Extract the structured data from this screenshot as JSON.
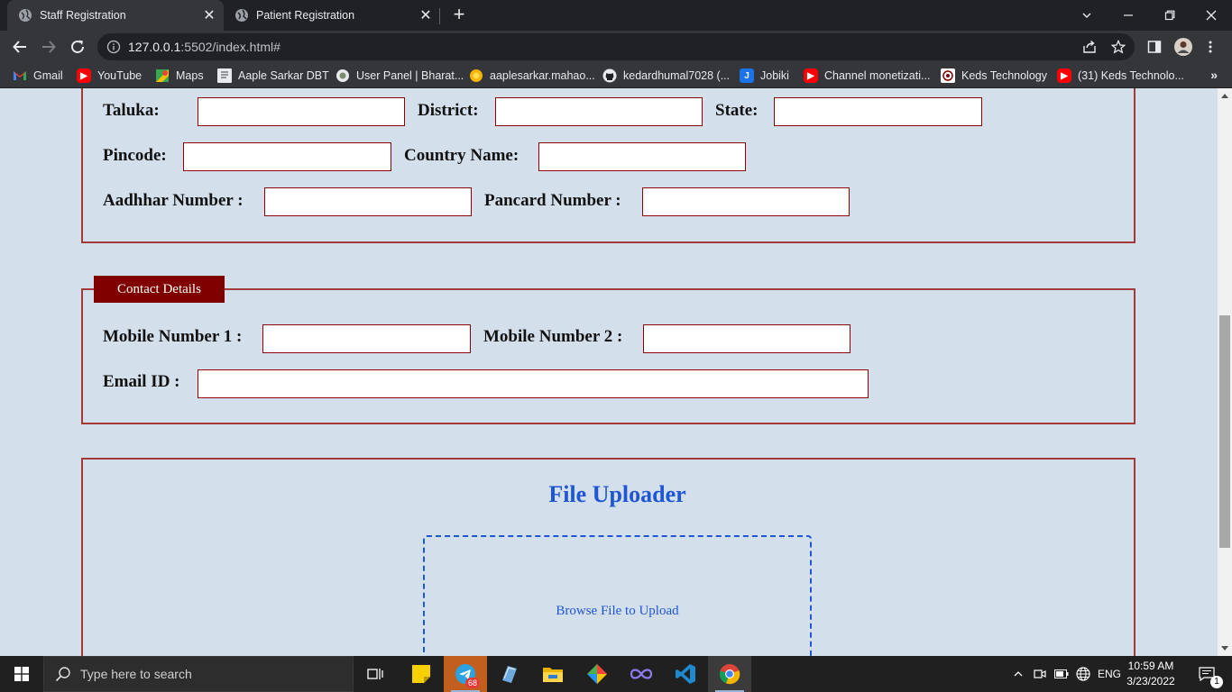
{
  "browser": {
    "tabs": [
      {
        "title": "Staff Registration",
        "active": true
      },
      {
        "title": "Patient Registration",
        "active": false
      }
    ],
    "url": {
      "host": "127.0.0.1",
      "rest": ":5502/index.html#"
    },
    "bookmarks": [
      {
        "label": "Gmail",
        "icon": "gmail-icon"
      },
      {
        "label": "YouTube",
        "icon": "youtube-icon"
      },
      {
        "label": "Maps",
        "icon": "maps-icon"
      },
      {
        "label": "Aaple Sarkar DBT",
        "icon": "document-icon"
      },
      {
        "label": "User Panel | Bharat...",
        "icon": "globe-icon"
      },
      {
        "label": "aaplesarkar.mahao...",
        "icon": "sun-icon"
      },
      {
        "label": "kedardhumal7028 (...",
        "icon": "github-icon"
      },
      {
        "label": "Jobiki",
        "icon": "jobiki-icon"
      },
      {
        "label": "Channel monetizati...",
        "icon": "youtube-icon"
      },
      {
        "label": "Keds Technology",
        "icon": "keds-icon"
      },
      {
        "label": "(31) Keds Technolo...",
        "icon": "youtube-icon"
      }
    ],
    "more_bookmarks": "»"
  },
  "form": {
    "address": {
      "taluka_label": "Taluka:",
      "district_label": "District:",
      "state_label": "State:",
      "pincode_label": "Pincode:",
      "country_label": "Country Name:",
      "aadhaar_label": "Aadhhar Number :",
      "pancard_label": "Pancard Number :",
      "taluka_value": "",
      "district_value": "",
      "state_value": "",
      "pincode_value": "",
      "country_value": "",
      "aadhaar_value": "",
      "pancard_value": ""
    },
    "contact": {
      "legend": "Contact Details",
      "mobile1_label": "Mobile Number 1 :",
      "mobile2_label": "Mobile Number 2 :",
      "email_label": "Email ID :",
      "mobile1_value": "",
      "mobile2_value": "",
      "email_value": ""
    },
    "file_uploader": {
      "title": "File Uploader",
      "browse_text": "Browse File to Upload"
    }
  },
  "taskbar": {
    "search_placeholder": "Type here to search",
    "telegram_badge": "68",
    "language": "ENG",
    "time": "10:59 AM",
    "date": "3/23/2022",
    "notification_count": "1"
  },
  "colors": {
    "page_background": "#d4dfec",
    "fieldset_border": "#a33a3a",
    "legend_background": "#800000",
    "accent_blue": "#1e56d6"
  }
}
